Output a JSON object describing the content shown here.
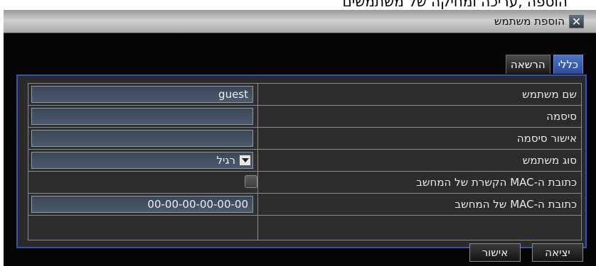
{
  "top_strip_text": "הוספה ,עריכה ומחיקה של משתמשים",
  "dialog": {
    "title": "הוספת משתמש",
    "close_glyph": "✕",
    "tabs": [
      {
        "label": "כללי",
        "active": true
      },
      {
        "label": "הרשאה",
        "active": false
      }
    ],
    "fields": {
      "username": {
        "label": "שם משתמש",
        "value": "guest"
      },
      "password": {
        "label": "סיסמה",
        "value": ""
      },
      "confirm_password": {
        "label": "אישור סיסמה",
        "value": ""
      },
      "user_type": {
        "label": "סוג משתמש",
        "value": "רגיל"
      },
      "bind_mac": {
        "label": "כתובת ה-MAC הקשרת של המחשב",
        "checked": false
      },
      "mac_address": {
        "label": "כתובת ה-MAC של המחשב",
        "value": "00-00-00-00-00-00"
      }
    },
    "buttons": {
      "ok": "אישור",
      "exit": "יציאה"
    }
  },
  "colors": {
    "tab_active": "#3a5fb5",
    "panel_border": "#2f55b6",
    "field_bg": "#414f60",
    "dialog_bg": "#050505"
  }
}
